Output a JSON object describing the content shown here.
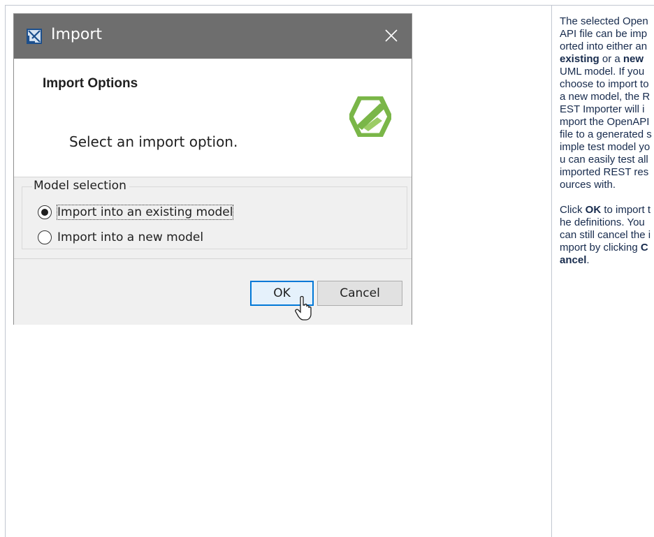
{
  "dialog": {
    "title": "Import",
    "header_title": "Import Options",
    "header_description": "Select an import option.",
    "group_label": "Model selection",
    "options": [
      {
        "label": "Import into an existing model",
        "selected": true
      },
      {
        "label": "Import into a new model",
        "selected": false
      }
    ],
    "ok_label": "OK",
    "cancel_label": "Cancel"
  },
  "side_note": {
    "p1_a": "The selected OpenAPI file can be imported into either an ",
    "p1_existing": "existing",
    "p1_b": " or a ",
    "p1_new": "new",
    "p1_c": " UML model. If you choose to import to a new model, the REST Importer will import the OpenAPI file to a generated simple test model you can easily test all imported REST resources with.",
    "p2_a": "Click ",
    "p2_ok": "OK",
    "p2_b": " to import the definitions. You can still cancel the import by clicking ",
    "p2_cancel": "Cancel",
    "p2_c": "."
  },
  "colors": {
    "titlebar": "#6e6e6e",
    "logo_green": "#7ab648",
    "ok_focus": "#0078d7"
  },
  "icons": [
    "app-icon",
    "close-icon",
    "product-logo",
    "mouse-cursor-icon"
  ]
}
